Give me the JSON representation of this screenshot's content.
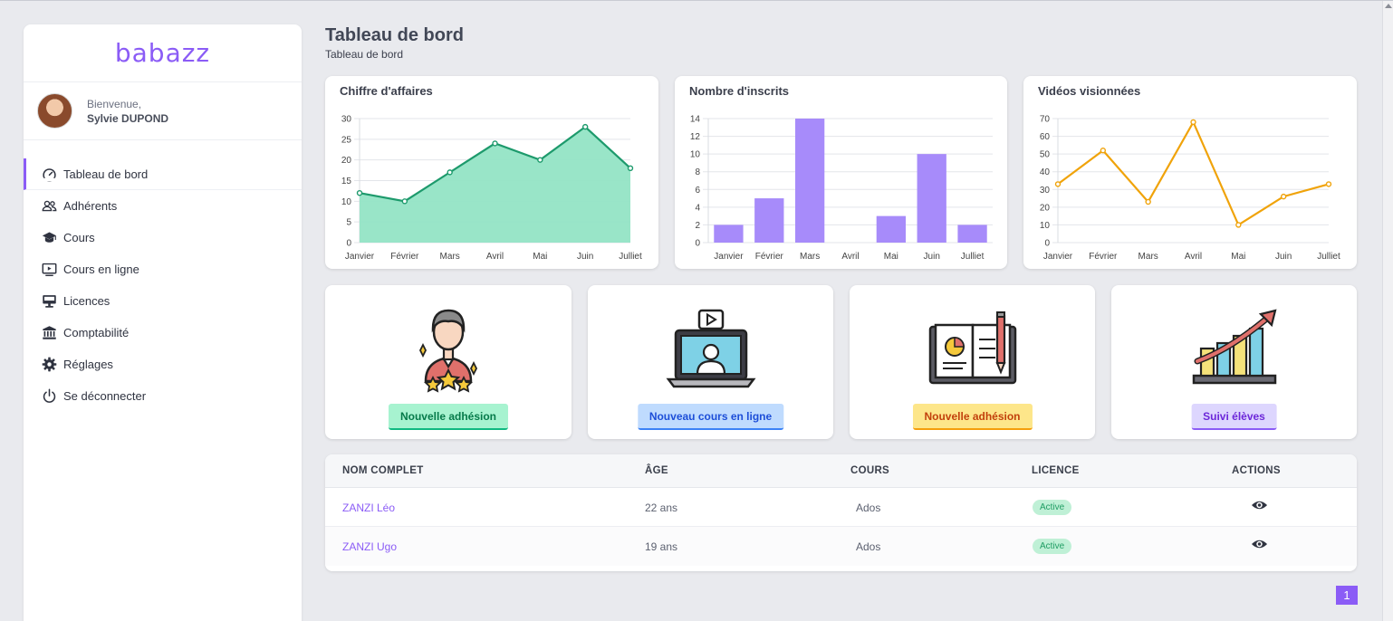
{
  "app": {
    "logo": "babazz"
  },
  "user": {
    "welcome": "Bienvenue,",
    "name": "Sylvie DUPOND"
  },
  "nav": [
    {
      "label": "Tableau de bord",
      "icon": "gauge-icon",
      "active": true
    },
    {
      "label": "Adhérents",
      "icon": "users-icon"
    },
    {
      "label": "Cours",
      "icon": "graduation-cap-icon"
    },
    {
      "label": "Cours en ligne",
      "icon": "video-screen-icon"
    },
    {
      "label": "Licences",
      "icon": "monitor-icon"
    },
    {
      "label": "Comptabilité",
      "icon": "bank-icon"
    },
    {
      "label": "Réglages",
      "icon": "gear-icon"
    },
    {
      "label": "Se déconnecter",
      "icon": "power-icon"
    }
  ],
  "header": {
    "title": "Tableau de bord",
    "breadcrumb": "Tableau de bord"
  },
  "chart_data": [
    {
      "type": "area",
      "title": "Chiffre d'affaires",
      "categories": [
        "Janvier",
        "Février",
        "Mars",
        "Avril",
        "Mai",
        "Juin",
        "Julliet"
      ],
      "values": [
        12,
        10,
        17,
        24,
        20,
        28,
        18
      ],
      "ylim": [
        0,
        30
      ],
      "yticks": [
        0,
        5,
        10,
        15,
        20,
        25,
        30
      ],
      "color": "#1d9a6c",
      "fill": "#93e4c5",
      "grid": true
    },
    {
      "type": "bar",
      "title": "Nombre d'inscrits",
      "categories": [
        "Janvier",
        "Février",
        "Mars",
        "Avril",
        "Mai",
        "Juin",
        "Julliet"
      ],
      "values": [
        2,
        5,
        14,
        0,
        3,
        10,
        2
      ],
      "ylim": [
        0,
        14
      ],
      "yticks": [
        0,
        2,
        4,
        6,
        8,
        10,
        12,
        14
      ],
      "color": "#a78bfa",
      "grid": true
    },
    {
      "type": "line",
      "title": "Vidéos visionnées",
      "categories": [
        "Janvier",
        "Février",
        "Mars",
        "Avril",
        "Mai",
        "Juin",
        "Julliet"
      ],
      "values": [
        33,
        52,
        23,
        68,
        10,
        26,
        33
      ],
      "ylim": [
        0,
        70
      ],
      "yticks": [
        0,
        10,
        20,
        30,
        40,
        50,
        60,
        70
      ],
      "color": "#f0a30a",
      "grid": true
    }
  ],
  "actions": [
    {
      "label": "Nouvelle adhésion",
      "illustration": "member-stars-illustration",
      "bg": "#a7f3d0",
      "fg": "#067a4a",
      "border": "#10b981"
    },
    {
      "label": "Nouveau cours en ligne",
      "illustration": "laptop-video-illustration",
      "bg": "#bfdbfe",
      "fg": "#1d4ed8",
      "border": "#3b82f6"
    },
    {
      "label": "Nouvelle adhésion",
      "illustration": "book-chart-illustration",
      "bg": "#fde68a",
      "fg": "#c2410c",
      "border": "#f59e0b"
    },
    {
      "label": "Suivi élèves",
      "illustration": "growth-chart-illustration",
      "bg": "#ddd6fe",
      "fg": "#6d28d9",
      "border": "#8b5cf6"
    }
  ],
  "table": {
    "headers": [
      "NOM COMPLET",
      "ÂGE",
      "COURS",
      "LICENCE",
      "ACTIONS"
    ],
    "rows": [
      {
        "name": "ZANZI Léo",
        "age": "22 ans",
        "course": "Ados",
        "license": "Active"
      },
      {
        "name": "ZANZI Ugo",
        "age": "19 ans",
        "course": "Ados",
        "license": "Active"
      }
    ]
  },
  "pagination": {
    "page": "1"
  }
}
